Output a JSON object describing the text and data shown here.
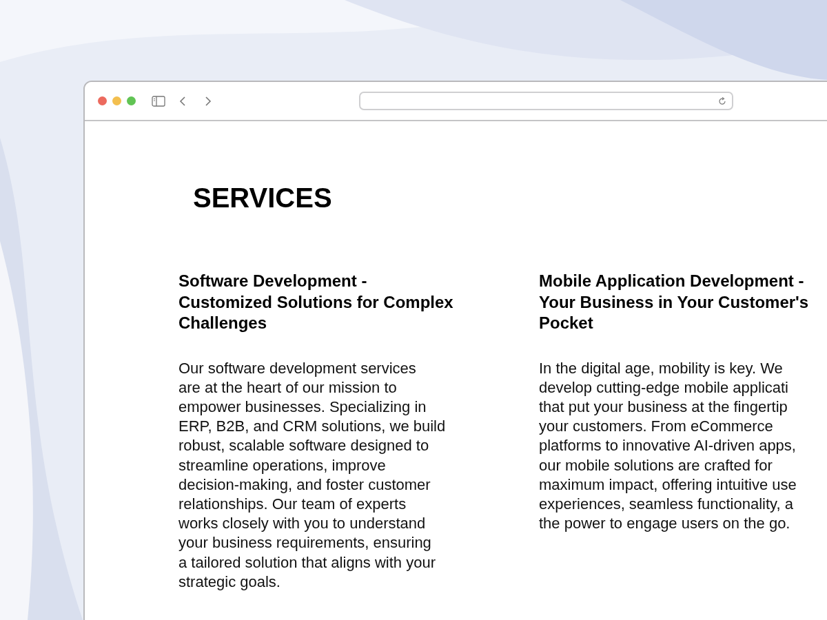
{
  "page": {
    "title": "SERVICES"
  },
  "services": [
    {
      "title_lines": [
        "Software Development -",
        "Customized Solutions for Complex",
        "Challenges"
      ],
      "body_lines": [
        "Our software development services",
        "are at the heart of our mission to",
        "empower businesses. Specializing in",
        "ERP, B2B, and CRM solutions, we build",
        "robust, scalable software designed to",
        "streamline operations, improve",
        "decision-making, and foster customer",
        "relationships. Our team of experts",
        "works closely with you to understand",
        "your business requirements, ensuring",
        "a tailored solution that aligns with your",
        "strategic goals."
      ]
    },
    {
      "title_lines": [
        "Mobile Application Development -",
        "Your Business in Your Customer's",
        "Pocket"
      ],
      "body_lines": [
        "In the digital age, mobility is key. We",
        "develop cutting-edge mobile applicati",
        "that put your business at the fingertip",
        "your customers. From eCommerce",
        "platforms to innovative AI-driven apps,",
        "our mobile solutions are crafted for",
        "maximum impact, offering intuitive use",
        "experiences, seamless functionality, a",
        "the power to engage users on the go."
      ]
    }
  ]
}
